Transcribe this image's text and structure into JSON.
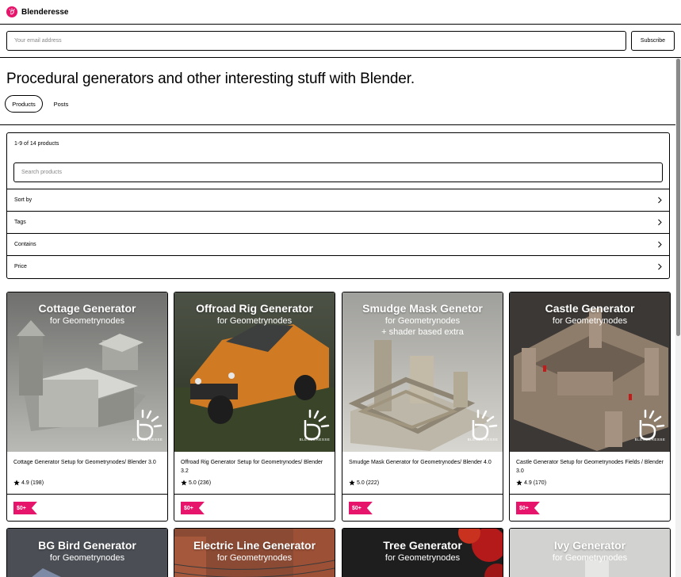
{
  "brand": {
    "name": "Blenderesse",
    "accent": "#e6156b",
    "logo_icon": "spiral-hand-logo"
  },
  "subscribe": {
    "placeholder": "Your email address",
    "button_label": "Subscribe"
  },
  "header": {
    "headline": "Procedural generators and other interesting stuff with Blender.",
    "tabs": [
      {
        "label": "Products",
        "active": true
      },
      {
        "label": "Posts",
        "active": false
      }
    ]
  },
  "filters": {
    "count_text": "1-9 of 14 products",
    "search_placeholder": "Search products",
    "rows": [
      {
        "label": "Sort by"
      },
      {
        "label": "Tags"
      },
      {
        "label": "Contains"
      },
      {
        "label": "Price"
      }
    ],
    "chevron_icon": "chevron-right-icon"
  },
  "products": [
    {
      "thumb_title": "Cottage Generator",
      "thumb_subtitle": "for Geometrynodes",
      "thumb_extra": "",
      "watermark": "BLENDERESSE",
      "name": "Cottage Generator Setup for Geometrynodes/ Blender 3.0",
      "rating": "4.9",
      "reviews": "(198)",
      "price": "$0+"
    },
    {
      "thumb_title": "Offroad Rig Generator",
      "thumb_subtitle": "for Geometrynodes",
      "thumb_extra": "",
      "watermark": "BLENDERESSE",
      "name": "Offroad Rig Generator Setup for Geometrynodes/ Blender 3.2",
      "rating": "5.0",
      "reviews": "(236)",
      "price": "$0+"
    },
    {
      "thumb_title": "Smudge Mask Genetor",
      "thumb_subtitle": "for Geometrynodes",
      "thumb_extra": "+ shader based extra",
      "watermark": "BLENDERESSE",
      "name": "Smudge Mask Generator for Geometrynodes/ Blender 4.0",
      "rating": "5.0",
      "reviews": "(222)",
      "price": "$0+"
    },
    {
      "thumb_title": "Castle Generator",
      "thumb_subtitle": "for Geometrynodes",
      "thumb_extra": "",
      "watermark": "BLENDERESSE",
      "name": "Castle Generator Setup for Geometrynodes Fields / Blender 3.0",
      "rating": "4.9",
      "reviews": "(170)",
      "price": "$0+"
    }
  ],
  "products_row2": [
    {
      "thumb_title": "BG Bird Generator",
      "thumb_subtitle": "for Geometrynodes"
    },
    {
      "thumb_title": "Electric Line Generator",
      "thumb_subtitle": "for Geometrynodes"
    },
    {
      "thumb_title": "Tree Generator",
      "thumb_subtitle": "for Geometrynodes"
    },
    {
      "thumb_title": "Ivy Generator",
      "thumb_subtitle": "for Geometrynodes"
    }
  ]
}
